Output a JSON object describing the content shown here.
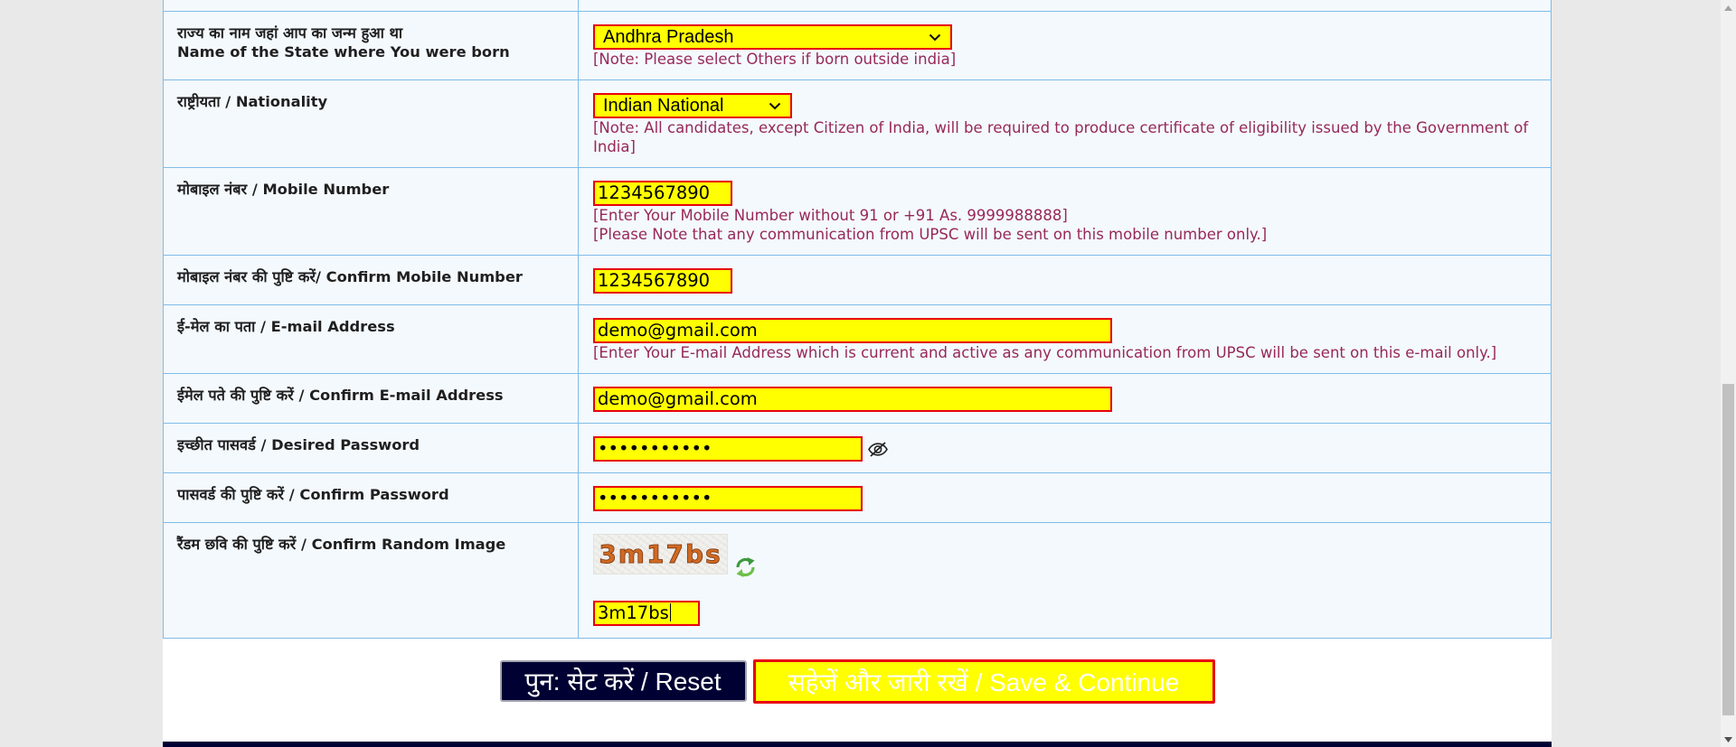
{
  "form": {
    "birth_state": {
      "label_hi": "राज्य का नाम जहां आप का जन्म हुआ था",
      "label_en": "Name of the State where You were born",
      "selected": "Andhra Pradesh",
      "note": "[Note: Please select Others if born outside india]"
    },
    "nationality": {
      "label": "राष्ट्रीयता / Nationality",
      "selected": "Indian National",
      "note": "[Note: All candidates, except Citizen of India, will be required to produce certificate of eligibility issued by the Government of India]"
    },
    "mobile": {
      "label": "मोबाइल नंबर / Mobile Number",
      "value": "1234567890",
      "notes": [
        "[Enter Your Mobile Number without 91 or +91 As. 9999988888]",
        "[Please Note that any communication from UPSC will be sent on this mobile number only.]"
      ]
    },
    "confirm_mobile": {
      "label": "मोबाइल नंबर की पुष्टि करें/ Confirm Mobile Number",
      "value": "1234567890"
    },
    "email": {
      "label": "ई-मेल का पता / E-mail Address",
      "value": "demo@gmail.com",
      "note": "[Enter Your E-mail Address which is current and active as any communication from UPSC will be sent on this e-mail only.]"
    },
    "confirm_email": {
      "label": "ईमेल पते की पुष्टि करें / Confirm E-mail Address",
      "value": "demo@gmail.com"
    },
    "password": {
      "label": "इच्छीत पासवर्ड / Desired Password",
      "masked_value": "•••••••••••",
      "toggle_icon": "eye-slash-icon"
    },
    "confirm_password": {
      "label": "पासवर्ड की पुष्टि करें / Confirm Password",
      "masked_value": "•••••••••••"
    },
    "captcha": {
      "label": "रैंडम छवि की पुष्टि करें / Confirm Random Image",
      "image_text": "3m17bs",
      "refresh_icon": "refresh-icon",
      "value": "3m17bs"
    }
  },
  "actions": {
    "reset_label": "पुन: सेट करें / Reset",
    "save_label": "सहेजें और जारी रखें / Save & Continue"
  },
  "icons": {
    "select_arrow": "chevron-down-icon",
    "scroll_up": "scroll-up-arrow-icon",
    "scroll_down": "scroll-down-arrow-icon"
  },
  "colors": {
    "field_background": "#ffff00",
    "field_border": "#e8000e",
    "note_text": "#97285a",
    "reset_button": "#000033",
    "table_border": "#7fbce8"
  }
}
